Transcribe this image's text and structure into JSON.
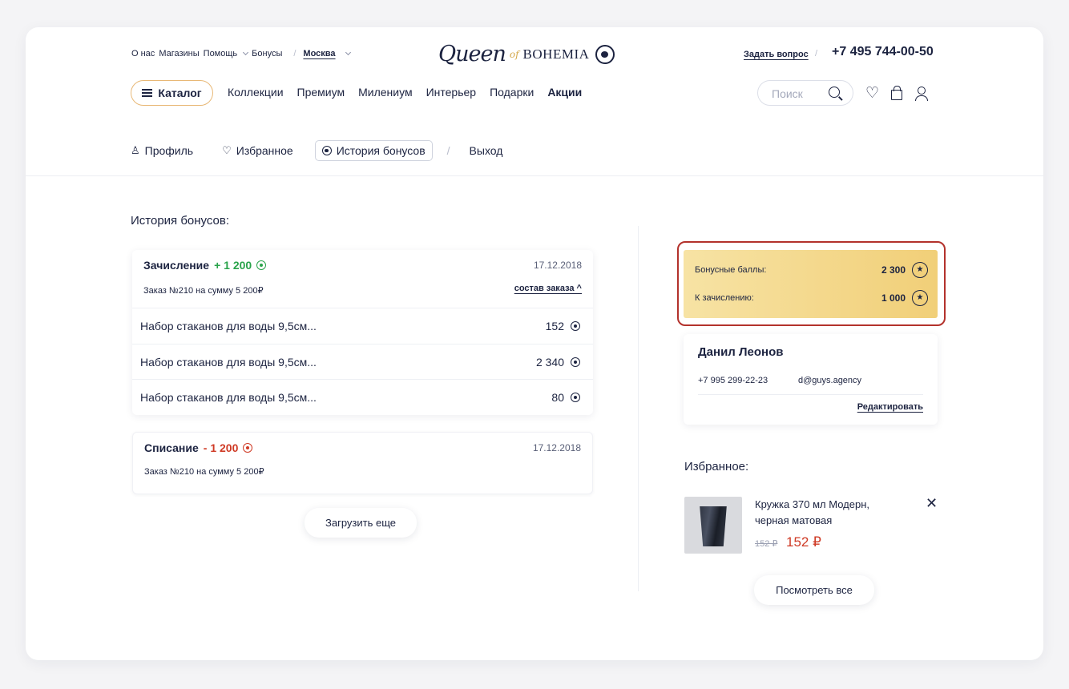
{
  "header": {
    "top_links": [
      "О нас",
      "Магазины",
      "Помощь",
      "Бонусы"
    ],
    "city": "Москва",
    "logo": {
      "queen": "Queen",
      "of": "of",
      "bohemia": "BOHEMIA"
    },
    "ask_link": "Задать вопрос",
    "phone": "+7 495 744-00-50"
  },
  "nav": {
    "catalog_label": "Каталог",
    "items": [
      "Коллекции",
      "Премиум",
      "Милениум",
      "Интерьер",
      "Подарки"
    ],
    "highlight": "Акции",
    "search_placeholder": "Поиск"
  },
  "profile_tabs": {
    "profile": "Профиль",
    "favorites": "Избранное",
    "bonus_history": "История бонусов",
    "logout": "Выход"
  },
  "history": {
    "title": "История бонусов:",
    "accrual": {
      "label": "Зачисление",
      "amount": "+ 1 200",
      "date": "17.12.2018",
      "order": "Заказ №210 на сумму 5 200₽",
      "toggle": "состав заказа ^",
      "items": [
        {
          "name": "Набор стаканов для воды 9,5см...",
          "value": "152"
        },
        {
          "name": "Набор стаканов для воды 9,5см...",
          "value": "2 340"
        },
        {
          "name": "Набор стаканов для воды 9,5см...",
          "value": "80"
        }
      ]
    },
    "writeoff": {
      "label": "Списание",
      "amount": "- 1 200",
      "date": "17.12.2018",
      "order": "Заказ №210 на сумму 5 200₽"
    },
    "load_more": "Загрузить еще"
  },
  "bonus": {
    "points_label": "Бонусные баллы:",
    "points_value": "2 300",
    "pending_label": "К зачислению:",
    "pending_value": "1 000"
  },
  "user": {
    "name": "Данил Леонов",
    "phone": "+7 995 299-22-23",
    "email": "d@guys.agency",
    "edit": "Редактировать"
  },
  "favorites": {
    "title": "Избранное:",
    "item": {
      "name": "Кружка 370 мл Модерн, черная матовая",
      "old_price": "152 ₽",
      "price": "152 ₽"
    },
    "view_all": "Посмотреть все"
  },
  "colors": {
    "accent_green": "#2aa34b",
    "accent_red": "#cf3a25",
    "bonus_gold": "#f1cf78",
    "highlight_border": "#b3322c",
    "navy": "#1c2340"
  }
}
